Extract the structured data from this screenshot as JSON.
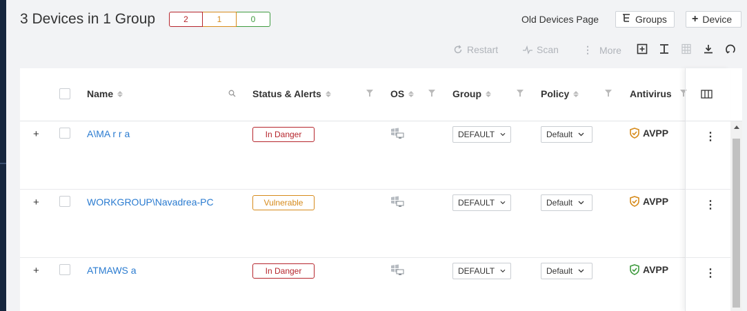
{
  "page": {
    "title": "3 Devices in 1 Group",
    "counts": {
      "danger": "2",
      "vulnerable": "1",
      "ok": "0"
    },
    "old_devices_link": "Old Devices Page",
    "groups_button": "Groups",
    "device_button": "Device"
  },
  "toolbar": {
    "restart": "Restart",
    "scan": "Scan",
    "more": "More"
  },
  "table": {
    "columns": {
      "name": "Name",
      "status": "Status & Alerts",
      "os": "OS",
      "group": "Group",
      "policy": "Policy",
      "antivirus": "Antivirus"
    },
    "rows": [
      {
        "name": "A\\MA  r  r  a",
        "status": "In Danger",
        "status_type": "danger",
        "group": "DEFAULT",
        "policy": "Default",
        "antivirus": "AVPP",
        "av_color": "#d68a1a"
      },
      {
        "name": "WORKGROUP\\Navadrea-PC",
        "status": "Vulnerable",
        "status_type": "vuln",
        "group": "DEFAULT",
        "policy": "Default",
        "antivirus": "AVPP",
        "av_color": "#d68a1a"
      },
      {
        "name": "ATMAWS  a",
        "status": "In Danger",
        "status_type": "danger",
        "group": "DEFAULT",
        "policy": "Default",
        "antivirus": "AVPP",
        "av_color": "#3e9a3e"
      }
    ]
  },
  "colors": {
    "danger": "#b5242b",
    "vulnerable": "#d68a1a",
    "ok": "#3e9a3e",
    "link": "#2a7bd0"
  }
}
